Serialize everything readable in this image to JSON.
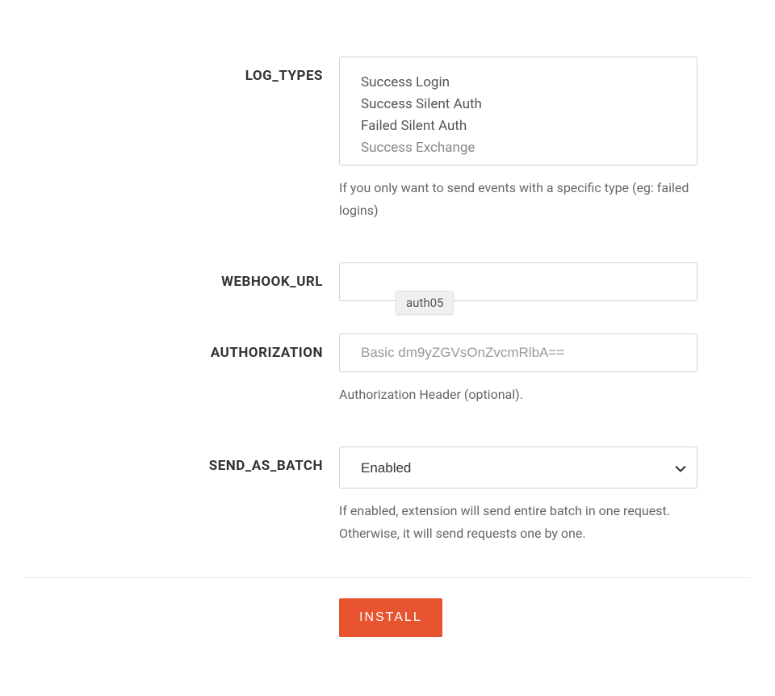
{
  "fields": {
    "log_types": {
      "label": "LOG_TYPES",
      "options": [
        "Success Login",
        "Success Silent Auth",
        "Failed Silent Auth",
        "Success Exchange"
      ],
      "description": "If you only want to send events with a specific type (eg: failed logins)"
    },
    "webhook_url": {
      "label": "WEBHOOK_URL",
      "value": "",
      "autocomplete_hint": "auth05"
    },
    "authorization": {
      "label": "AUTHORIZATION",
      "placeholder": "Basic dm9yZGVsOnZvcmRlbA==",
      "description": "Authorization Header (optional)."
    },
    "send_as_batch": {
      "label": "SEND_AS_BATCH",
      "selected": "Enabled",
      "description": "If enabled, extension will send entire batch in one request. Otherwise, it will send requests one by one."
    }
  },
  "footer": {
    "install_label": "INSTALL"
  }
}
